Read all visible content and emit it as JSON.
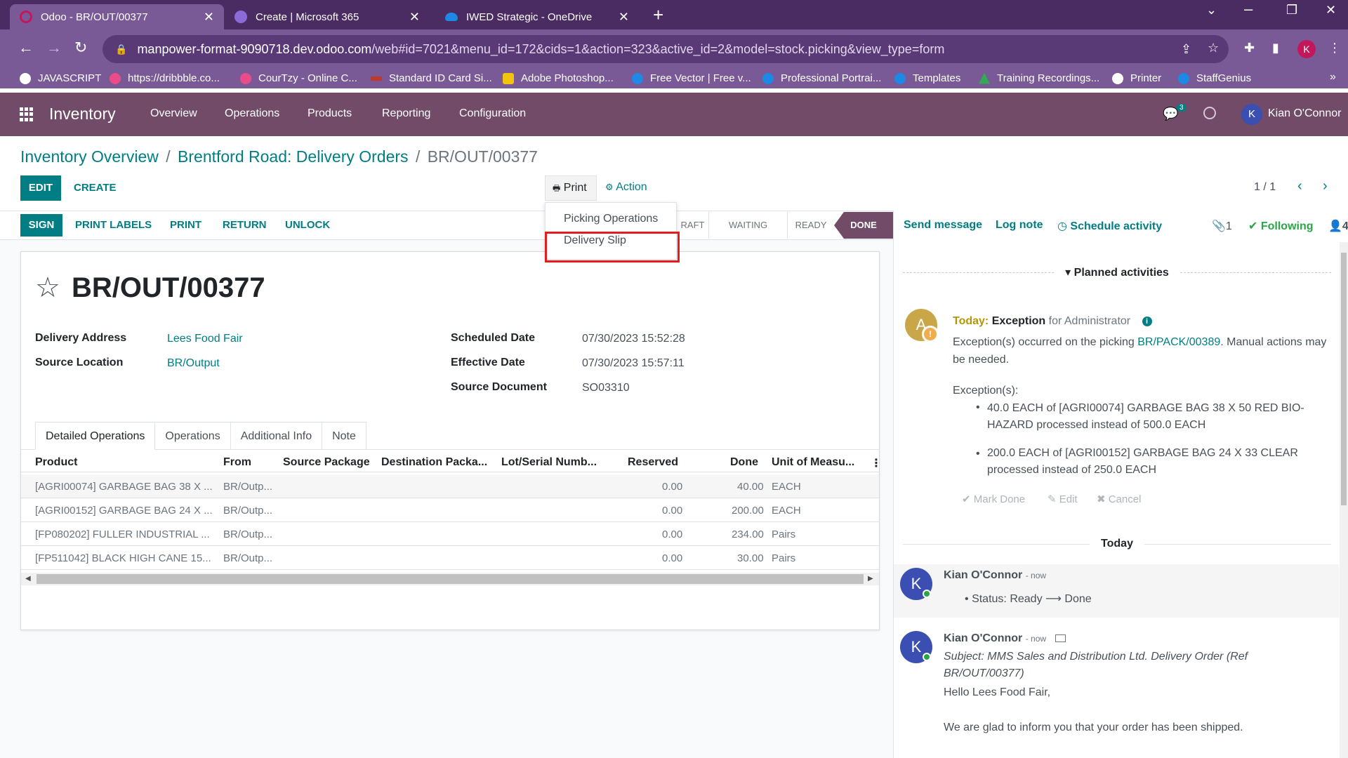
{
  "browser": {
    "tabs": [
      {
        "title": "Odoo - BR/OUT/00377",
        "color": "#c2185b"
      },
      {
        "title": "Create | Microsoft 365",
        "color": "#8c6bd8"
      },
      {
        "title": "IWED Strategic - OneDrive",
        "color": "#1e88e5"
      }
    ],
    "url_host": "manpower-format-9090718.dev.odoo.com",
    "url_path": "/web#id=7021&menu_id=172&cids=1&action=323&active_id=2&model=stock.picking&view_type=form",
    "profile_initial": "K",
    "bookmarks": [
      {
        "label": "JAVASCRIPT",
        "color": "#ffffff"
      },
      {
        "label": "https://dribbble.co...",
        "color": "#ea4c89"
      },
      {
        "label": "CourTzy - Online C...",
        "color": "#ea4c89"
      },
      {
        "label": "Standard ID Card Si...",
        "color": "#c0392b"
      },
      {
        "label": "Adobe Photoshop...",
        "color": "#f1c40f"
      },
      {
        "label": "Free Vector | Free v...",
        "color": "#1e88e5"
      },
      {
        "label": "Professional Portrai...",
        "color": "#1e88e5"
      },
      {
        "label": "Templates",
        "color": "#1e88e5"
      },
      {
        "label": "Training Recordings...",
        "color": "#34a853"
      },
      {
        "label": "Printer",
        "color": "#ffffff"
      },
      {
        "label": "StaffGenius",
        "color": "#1e88e5"
      }
    ]
  },
  "odoo_nav": {
    "app_name": "Inventory",
    "menus": [
      "Overview",
      "Operations",
      "Products",
      "Reporting",
      "Configuration"
    ],
    "chat_count": "3",
    "user_initial": "K",
    "user_name": "Kian O'Connor"
  },
  "breadcrumb": {
    "items": [
      "Inventory Overview",
      "Brentford Road: Delivery Orders"
    ],
    "separator": "/",
    "current": "BR/OUT/00377"
  },
  "controls": {
    "edit": "EDIT",
    "create": "CREATE",
    "print": "Print",
    "action": "Action",
    "pager": "1 / 1"
  },
  "print_menu": {
    "items": [
      "Picking Operations",
      "Delivery Slip"
    ]
  },
  "header_buttons": {
    "sign": "SIGN",
    "print_labels": "PRINT LABELS",
    "print": "PRINT",
    "return": "RETURN",
    "unlock": "UNLOCK"
  },
  "stages": {
    "draft": "RAFT",
    "waiting": "WAITING",
    "ready": "READY",
    "done": "DONE"
  },
  "record": {
    "name": "BR/OUT/00377",
    "fields": {
      "delivery_address_label": "Delivery Address",
      "delivery_address": "Lees Food Fair",
      "source_location_label": "Source Location",
      "source_location": "BR/Output",
      "scheduled_date_label": "Scheduled Date",
      "scheduled_date": "07/30/2023 15:52:28",
      "effective_date_label": "Effective Date",
      "effective_date": "07/30/2023 15:57:11",
      "source_document_label": "Source Document",
      "source_document": "SO03310"
    }
  },
  "notebook": {
    "tabs": [
      "Detailed Operations",
      "Operations",
      "Additional Info",
      "Note"
    ]
  },
  "table": {
    "columns": [
      "Product",
      "From",
      "Source Package",
      "Destination Packa...",
      "Lot/Serial Numb...",
      "Reserved",
      "Done",
      "Unit of Measu..."
    ],
    "rows": [
      {
        "product": "[AGRI00074] GARBAGE BAG 38 X ...",
        "from": "BR/Outp...",
        "reserved": "0.00",
        "done": "40.00",
        "uom": "EACH"
      },
      {
        "product": "[AGRI00152] GARBAGE BAG 24 X ...",
        "from": "BR/Outp...",
        "reserved": "0.00",
        "done": "200.00",
        "uom": "EACH"
      },
      {
        "product": "[FP080202] FULLER INDUSTRIAL ...",
        "from": "BR/Outp...",
        "reserved": "0.00",
        "done": "234.00",
        "uom": "Pairs"
      },
      {
        "product": "[FP511042] BLACK HIGH CANE 15...",
        "from": "BR/Outp...",
        "reserved": "0.00",
        "done": "30.00",
        "uom": "Pairs"
      }
    ]
  },
  "chatter": {
    "send_message": "Send message",
    "log_note": "Log note",
    "schedule_activity": "Schedule activity",
    "attachments": "1",
    "following": "Following",
    "followers": "4",
    "planned_activities": "Planned activities",
    "activity": {
      "avatar_initial": "A",
      "today": "Today:",
      "type": "Exception",
      "for": "for Administrator",
      "line1": "Exception(s) occurred on the picking ",
      "link": "BR/PACK/00389",
      "line1_end": ". Manual actions may",
      "line2": "be needed.",
      "exceptions_label": "Exception(s):",
      "exceptions": [
        "40.0 EACH of [AGRI00074] GARBAGE BAG 38 X 50 RED BIO-HAZARD processed instead of 500.0 EACH",
        "200.0 EACH of [AGRI00152] GARBAGE BAG 24 X 33 CLEAR processed instead of 250.0 EACH"
      ],
      "mark_done": "Mark Done",
      "edit": "Edit",
      "cancel": "Cancel"
    },
    "today_label": "Today",
    "messages": [
      {
        "author": "Kian O'Connor",
        "time": "- now",
        "status_label": "Status: Ready",
        "status_to": "Done"
      },
      {
        "author": "Kian O'Connor",
        "time": "- now",
        "subject": "Subject: MMS Sales and Distribution Ltd. Delivery Order (Ref BR/OUT/00377)",
        "greeting": "Hello Lees Food Fair,",
        "body": "We are glad to inform you that your order has been shipped."
      }
    ]
  }
}
